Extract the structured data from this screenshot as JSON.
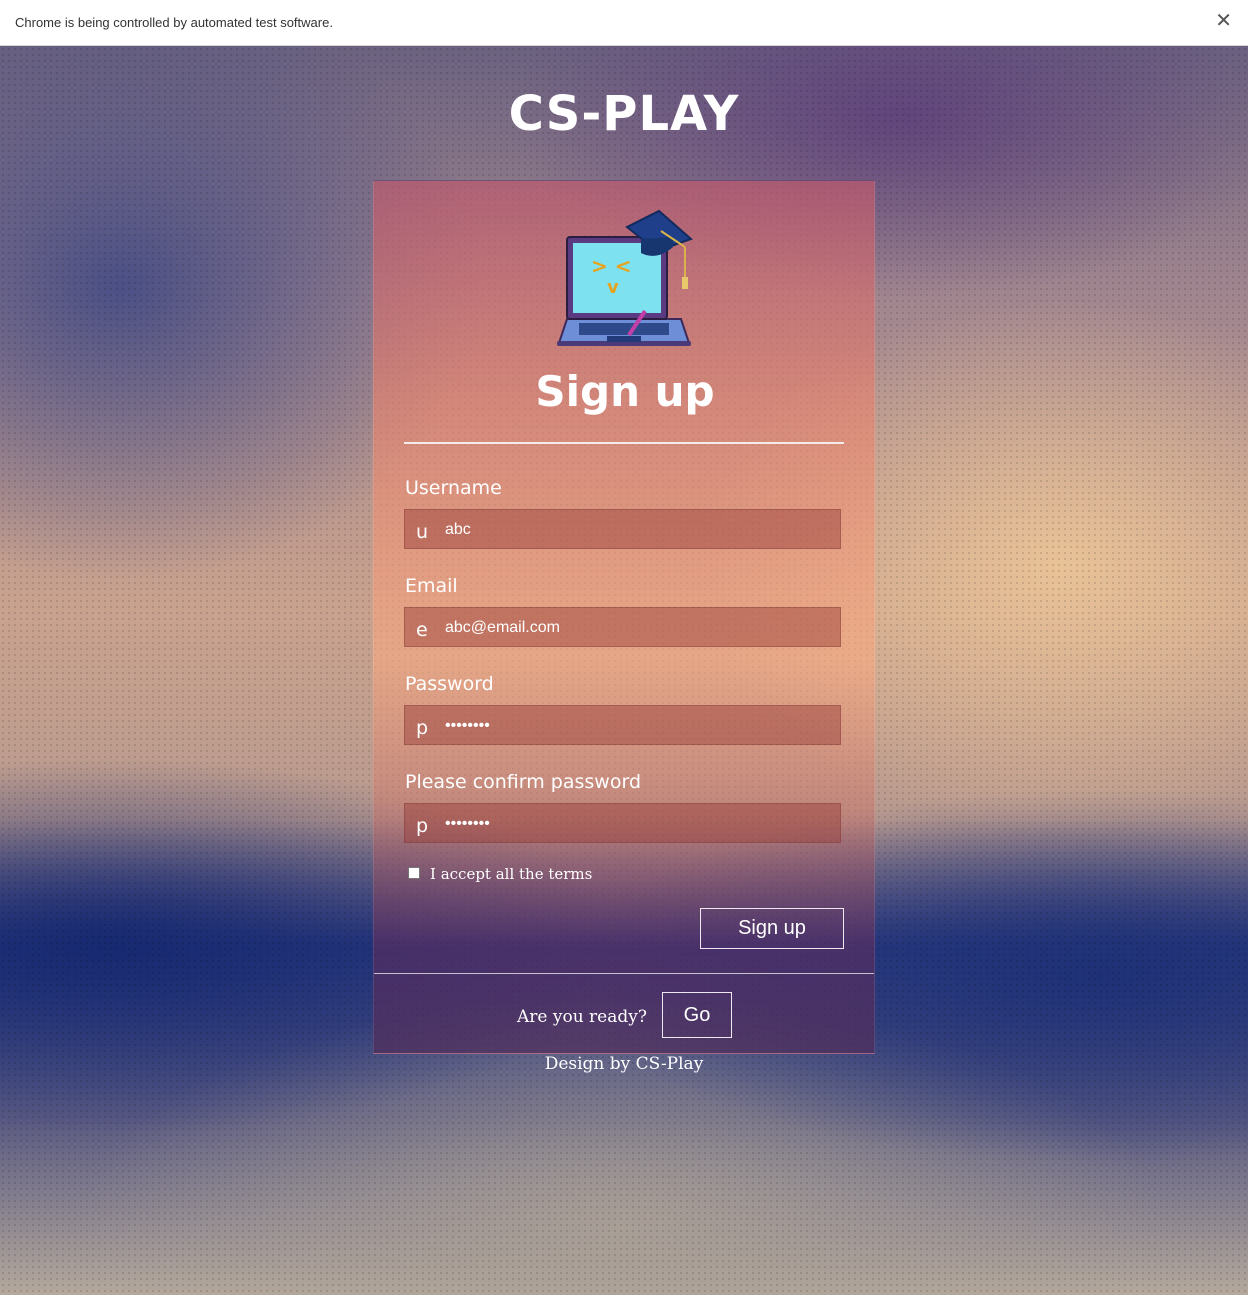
{
  "browser": {
    "infobar_text": "Chrome is being controlled by automated test software.",
    "close_glyph": "✕"
  },
  "site": {
    "title": "CS-PLAY"
  },
  "card": {
    "logo_icon": "laptop-graduation-cap-icon",
    "title": "Sign up",
    "fields": [
      {
        "label": "Username",
        "prefix": "u",
        "value": "abc",
        "type": "text"
      },
      {
        "label": "Email",
        "prefix": "e",
        "value": "abc@email.com",
        "type": "email"
      },
      {
        "label": "Password",
        "prefix": "p",
        "value": "abcdefgh",
        "type": "password"
      },
      {
        "label": "Please confirm password",
        "prefix": "p",
        "value": "abcdefgh",
        "type": "password"
      }
    ],
    "terms_label": "I accept all the terms",
    "terms_checked": false,
    "signup_button": "Sign up",
    "ready_text": "Are you ready?",
    "go_button": "Go"
  },
  "footer": {
    "text": "Design by CS-Play"
  }
}
